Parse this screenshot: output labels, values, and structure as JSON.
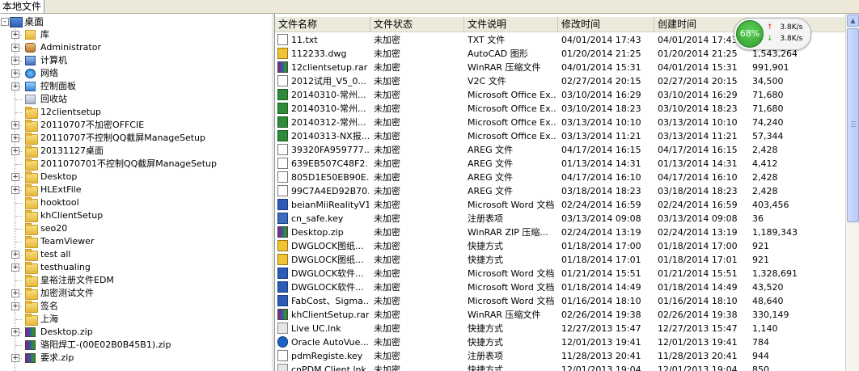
{
  "tab": {
    "label": "本地文件"
  },
  "tree": {
    "root": "桌面",
    "items": [
      {
        "label": "库",
        "icon": "library-icon",
        "expander": "+"
      },
      {
        "label": "Administrator",
        "icon": "user-icon",
        "expander": "+"
      },
      {
        "label": "计算机",
        "icon": "computer-icon",
        "expander": "+"
      },
      {
        "label": "网络",
        "icon": "network-icon",
        "expander": "+"
      },
      {
        "label": "控制面板",
        "icon": "control-panel-icon",
        "expander": "+"
      },
      {
        "label": "回收站",
        "icon": "recycle-bin-icon",
        "expander": ""
      },
      {
        "label": "12clientsetup",
        "icon": "folder-icon",
        "expander": ""
      },
      {
        "label": "20110707不加密OFFCIE",
        "icon": "folder-icon",
        "expander": "+"
      },
      {
        "label": "20110707不控制QQ截屏ManageSetup",
        "icon": "folder-icon",
        "expander": "+"
      },
      {
        "label": "20131127桌面",
        "icon": "folder-icon",
        "expander": "+"
      },
      {
        "label": "2011070701不控制QQ截屏ManageSetup",
        "icon": "folder-icon",
        "expander": ""
      },
      {
        "label": "Desktop",
        "icon": "folder-icon",
        "expander": "+"
      },
      {
        "label": "HLExtFile",
        "icon": "folder-icon",
        "expander": "+"
      },
      {
        "label": "hooktool",
        "icon": "folder-icon",
        "expander": ""
      },
      {
        "label": "khClientSetup",
        "icon": "folder-icon",
        "expander": ""
      },
      {
        "label": "seo20",
        "icon": "folder-icon",
        "expander": ""
      },
      {
        "label": "TeamViewer",
        "icon": "folder-icon",
        "expander": ""
      },
      {
        "label": "test all",
        "icon": "folder-icon",
        "expander": "+"
      },
      {
        "label": "testhualing",
        "icon": "folder-icon",
        "expander": "+"
      },
      {
        "label": "皇裕注册文件EDM",
        "icon": "folder-icon",
        "expander": ""
      },
      {
        "label": "加密测试文件",
        "icon": "folder-icon",
        "expander": "+"
      },
      {
        "label": "签名",
        "icon": "folder-icon",
        "expander": "+"
      },
      {
        "label": "上海",
        "icon": "folder-icon",
        "expander": ""
      },
      {
        "label": "Desktop.zip",
        "icon": "zip-archive-icon",
        "expander": "+"
      },
      {
        "label": "骆阳焊工-(00E02B0B45B1).zip",
        "icon": "zip-archive-icon",
        "expander": ""
      },
      {
        "label": "要求.zip",
        "icon": "zip-archive-icon",
        "expander": "+"
      }
    ]
  },
  "columns": [
    "文件名称",
    "文件状态",
    "文件说明",
    "修改时间",
    "创建时间",
    ""
  ],
  "files": [
    {
      "name": "11.txt",
      "status": "未加密",
      "desc": "TXT 文件",
      "modified": "04/01/2014 17:43",
      "created": "04/01/2014 17:43",
      "size": "",
      "icon": "text-file-icon",
      "ic": "ic-txt"
    },
    {
      "name": "112233.dwg",
      "status": "未加密",
      "desc": "AutoCAD 图形",
      "modified": "01/20/2014 21:25",
      "created": "01/20/2014 21:25",
      "size": "1,543,264",
      "icon": "dwg-file-icon",
      "ic": "ic-dwg"
    },
    {
      "name": "12clientsetup.rar",
      "status": "未加密",
      "desc": "WinRAR 压缩文件",
      "modified": "04/01/2014 15:31",
      "created": "04/01/2014 15:31",
      "size": "991,901",
      "icon": "rar-archive-icon",
      "ic": "ic-rar"
    },
    {
      "name": "2012试用_V5_0...",
      "status": "未加密",
      "desc": "V2C 文件",
      "modified": "02/27/2014 20:15",
      "created": "02/27/2014 20:15",
      "size": "34,500",
      "icon": "file-icon",
      "ic": "ic-txt"
    },
    {
      "name": "20140310-常州...",
      "status": "未加密",
      "desc": "Microsoft Office Ex...",
      "modified": "03/10/2014 16:29",
      "created": "03/10/2014 16:29",
      "size": "71,680",
      "icon": "excel-file-icon",
      "ic": "ic-xls"
    },
    {
      "name": "20140310-常州...",
      "status": "未加密",
      "desc": "Microsoft Office Ex...",
      "modified": "03/10/2014 18:23",
      "created": "03/10/2014 18:23",
      "size": "71,680",
      "icon": "excel-file-icon",
      "ic": "ic-xls"
    },
    {
      "name": "20140312-常州...",
      "status": "未加密",
      "desc": "Microsoft Office Ex...",
      "modified": "03/13/2014 10:10",
      "created": "03/13/2014 10:10",
      "size": "74,240",
      "icon": "excel-file-icon",
      "ic": "ic-xls"
    },
    {
      "name": "20140313-NX报...",
      "status": "未加密",
      "desc": "Microsoft Office Ex...",
      "modified": "03/13/2014 11:21",
      "created": "03/13/2014 11:21",
      "size": "57,344",
      "icon": "excel-file-icon",
      "ic": "ic-xls"
    },
    {
      "name": "39320FA959777...",
      "status": "未加密",
      "desc": "AREG 文件",
      "modified": "04/17/2014 16:15",
      "created": "04/17/2014 16:15",
      "size": "2,428",
      "icon": "file-icon",
      "ic": "ic-txt"
    },
    {
      "name": "639EB507C48F2...",
      "status": "未加密",
      "desc": "AREG 文件",
      "modified": "01/13/2014 14:31",
      "created": "01/13/2014 14:31",
      "size": "4,412",
      "icon": "file-icon",
      "ic": "ic-txt"
    },
    {
      "name": "805D1E50EB90E...",
      "status": "未加密",
      "desc": "AREG 文件",
      "modified": "04/17/2014 16:10",
      "created": "04/17/2014 16:10",
      "size": "2,428",
      "icon": "file-icon",
      "ic": "ic-txt"
    },
    {
      "name": "99C7A4ED92B70...",
      "status": "未加密",
      "desc": "AREG 文件",
      "modified": "03/18/2014 18:23",
      "created": "03/18/2014 18:23",
      "size": "2,428",
      "icon": "file-icon",
      "ic": "ic-txt"
    },
    {
      "name": "beianMiiRealityV1...",
      "status": "未加密",
      "desc": "Microsoft Word 文档",
      "modified": "02/24/2014 16:59",
      "created": "02/24/2014 16:59",
      "size": "403,456",
      "icon": "word-file-icon",
      "ic": "ic-doc"
    },
    {
      "name": "cn_safe.key",
      "status": "未加密",
      "desc": "注册表项",
      "modified": "03/13/2014 09:08",
      "created": "03/13/2014 09:08",
      "size": "36",
      "icon": "registry-file-icon",
      "ic": "ic-key"
    },
    {
      "name": "Desktop.zip",
      "status": "未加密",
      "desc": "WinRAR ZIP 压缩...",
      "modified": "02/24/2014 13:19",
      "created": "02/24/2014 13:19",
      "size": "1,189,343",
      "icon": "zip-archive-icon",
      "ic": "ic-rar"
    },
    {
      "name": "DWGLOCK图纸...",
      "status": "未加密",
      "desc": "快捷方式",
      "modified": "01/18/2014 17:00",
      "created": "01/18/2014 17:00",
      "size": "921",
      "icon": "shortcut-icon",
      "ic": "ic-dwg"
    },
    {
      "name": "DWGLOCK图纸...",
      "status": "未加密",
      "desc": "快捷方式",
      "modified": "01/18/2014 17:01",
      "created": "01/18/2014 17:01",
      "size": "921",
      "icon": "shortcut-icon",
      "ic": "ic-dwg"
    },
    {
      "name": "DWGLOCK软件...",
      "status": "未加密",
      "desc": "Microsoft Word 文档",
      "modified": "01/21/2014 15:51",
      "created": "01/21/2014 15:51",
      "size": "1,328,691",
      "icon": "word-file-icon",
      "ic": "ic-doc"
    },
    {
      "name": "DWGLOCK软件...",
      "status": "未加密",
      "desc": "Microsoft Word 文档",
      "modified": "01/18/2014 14:49",
      "created": "01/18/2014 14:49",
      "size": "43,520",
      "icon": "word-file-icon",
      "ic": "ic-doc"
    },
    {
      "name": "FabCost、Sigma...",
      "status": "未加密",
      "desc": "Microsoft Word 文档",
      "modified": "01/16/2014 18:10",
      "created": "01/16/2014 18:10",
      "size": "48,640",
      "icon": "word-file-icon",
      "ic": "ic-doc"
    },
    {
      "name": "khClientSetup.rar",
      "status": "未加密",
      "desc": "WinRAR 压缩文件",
      "modified": "02/26/2014 19:38",
      "created": "02/26/2014 19:38",
      "size": "330,149",
      "icon": "rar-archive-icon",
      "ic": "ic-rar"
    },
    {
      "name": "Live UC.lnk",
      "status": "未加密",
      "desc": "快捷方式",
      "modified": "12/27/2013 15:47",
      "created": "12/27/2013 15:47",
      "size": "1,140",
      "icon": "shortcut-icon",
      "ic": "ic-lnk"
    },
    {
      "name": "Oracle AutoVue...",
      "status": "未加密",
      "desc": "快捷方式",
      "modified": "12/01/2013 19:41",
      "created": "12/01/2013 19:41",
      "size": "784",
      "icon": "shortcut-icon",
      "ic": "ic-exe"
    },
    {
      "name": "pdmRegiste.key",
      "status": "未加密",
      "desc": "注册表项",
      "modified": "11/28/2013 20:41",
      "created": "11/28/2013 20:41",
      "size": "944",
      "icon": "registry-file-icon",
      "ic": "ic-txt"
    },
    {
      "name": "cnPDM Client.lnk",
      "status": "未加密",
      "desc": "快捷方式",
      "modified": "12/01/2013 19:04",
      "created": "12/01/2013 19:04",
      "size": "850",
      "icon": "shortcut-icon",
      "ic": "ic-lnk"
    }
  ],
  "netmon": {
    "percent": "68%",
    "up": "3.8K/s",
    "down": "3.8K/s",
    "up_arrow": "↑",
    "down_arrow": "↓"
  }
}
